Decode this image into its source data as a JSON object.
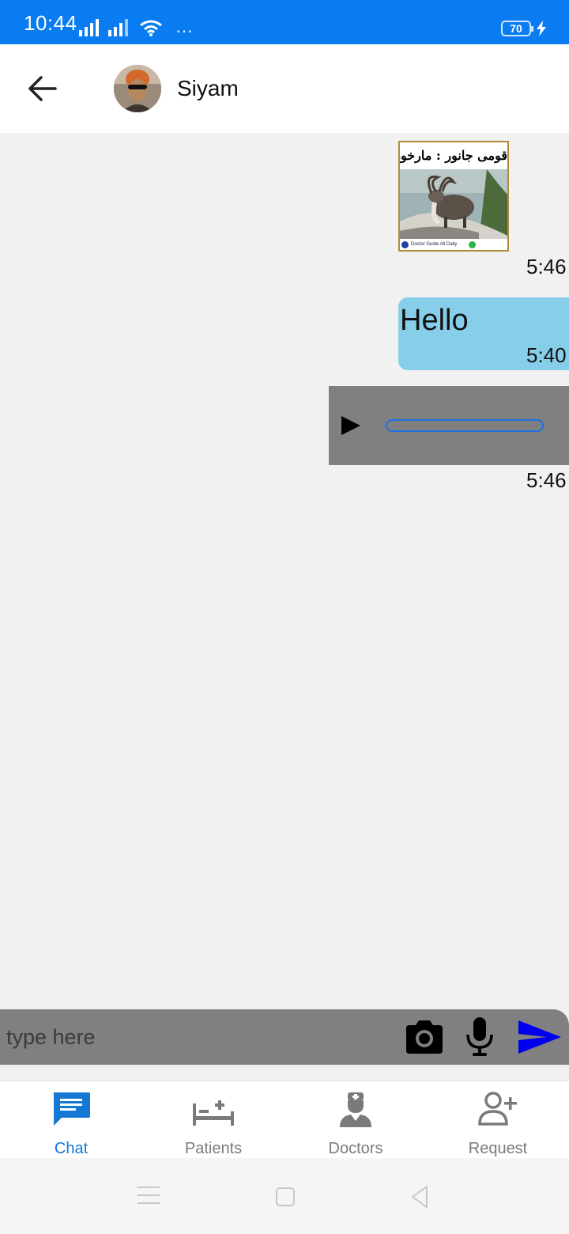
{
  "status_bar": {
    "time": "10:44",
    "battery": "70"
  },
  "header": {
    "contact_name": "Siyam"
  },
  "messages": [
    {
      "type": "image",
      "title": "قومی جانور : مارخور",
      "footer": "Doctor Guide All Daily",
      "time": "5:46"
    },
    {
      "type": "text",
      "text": "Hello",
      "time": "5:40"
    },
    {
      "type": "audio",
      "time": "5:46"
    }
  ],
  "input": {
    "placeholder": "type here"
  },
  "nav": {
    "items": [
      {
        "label": "Chat",
        "icon": "chat-icon",
        "active": true
      },
      {
        "label": "Patients",
        "icon": "bed-icon",
        "active": false
      },
      {
        "label": "Doctors",
        "icon": "doctor-icon",
        "active": false
      },
      {
        "label": "Request",
        "icon": "add-user-icon",
        "active": false
      }
    ]
  },
  "colors": {
    "status_bar": "#0a7cf2",
    "accent": "#1478d4",
    "bubble": "#87ceeb",
    "send": "#0000ee",
    "input_bar": "#808080"
  }
}
